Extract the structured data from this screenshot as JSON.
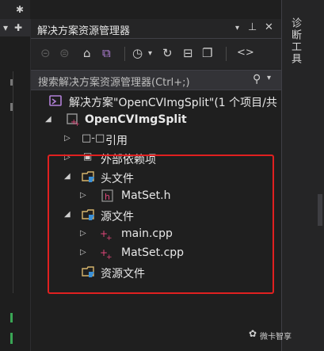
{
  "left_strip": {
    "tab_icon": "gear-icon",
    "toolbar_icons": [
      "dropdown-icon",
      "split-icon"
    ]
  },
  "panel": {
    "title": "解决方案资源管理器",
    "title_buttons": [
      "dropdown-arrow-icon",
      "pin-icon",
      "close-icon"
    ]
  },
  "toolbar": {
    "icons": [
      "back-icon",
      "forward-icon",
      "home-icon",
      "vs-switch-icon",
      "history-icon",
      "dropdown-icon",
      "refresh-icon",
      "collapse-all-icon",
      "show-all-files-icon",
      "code-icon"
    ]
  },
  "search": {
    "placeholder": "搜索解决方案资源管理器(Ctrl+;)"
  },
  "tree": {
    "solution": "解决方案\"OpenCVImgSplit\"(1 个项目/共",
    "project": "OpenCVImgSplit",
    "references": "引用",
    "external_deps": "外部依赖项",
    "headers_folder": "头文件",
    "header_file": "MatSet.h",
    "source_folder": "源文件",
    "source_main": "main.cpp",
    "source_matset": "MatSet.cpp",
    "resource_folder": "资源文件"
  },
  "right_strip": {
    "vertical_tab": "诊断工具"
  },
  "watermark": {
    "text": "微卡智享"
  },
  "colors": {
    "background": "#1f1f1f",
    "highlight": "#e02020",
    "cpp_icon": "#e0467a",
    "folder": "#d7b56d",
    "solution_icon": "#b180d7"
  }
}
